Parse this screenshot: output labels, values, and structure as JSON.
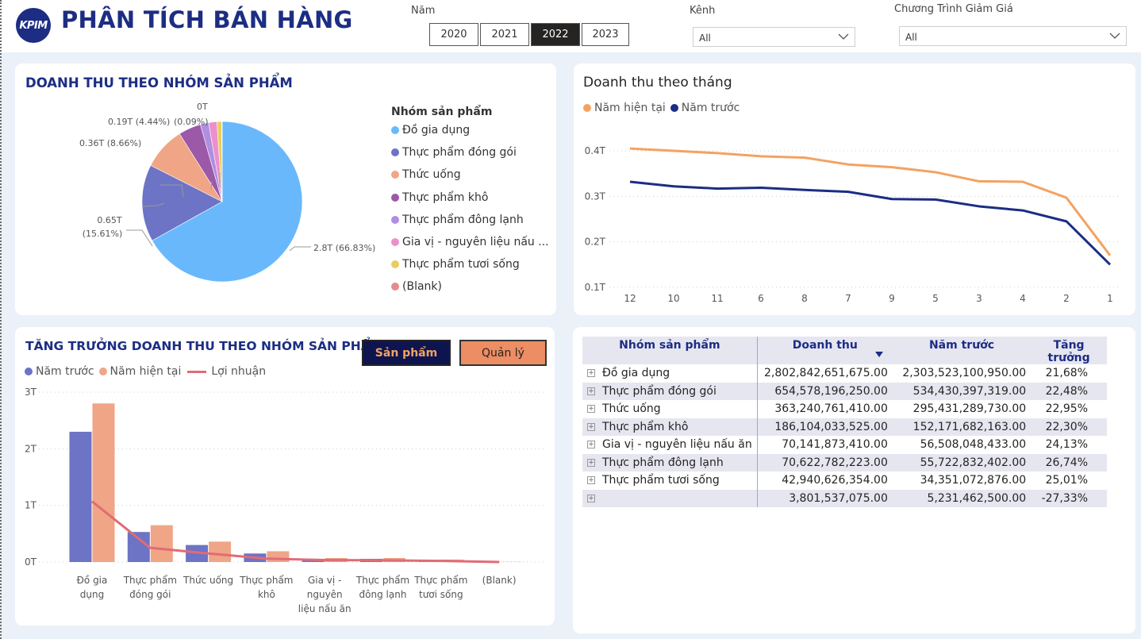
{
  "header": {
    "logo_text": "KPIM",
    "title": "PHÂN TÍCH BÁN HÀNG"
  },
  "filters": {
    "year_label": "Năm",
    "years": [
      "2020",
      "2021",
      "2022",
      "2023"
    ],
    "selected_year": "2022",
    "channel_label": "Kênh",
    "channel_value": "All",
    "discount_label": "Chương Trình Giảm Giá",
    "discount_value": "All"
  },
  "pie_card": {
    "title": "DOANH THU THEO NHÓM SẢN PHẨM",
    "legend_title": "Nhóm sản phẩm",
    "legend": [
      "Đồ gia dụng",
      "Thực phẩm đóng gói",
      "Thức uống",
      "Thực phẩm khô",
      "Thực phẩm đông lạnh",
      "Gia vị - nguyên liệu nấu ...",
      "Thực phẩm tươi sống",
      "(Blank)"
    ],
    "colors": [
      "#6ab8fc",
      "#6d73c5",
      "#f0a586",
      "#9b59a8",
      "#b08ee0",
      "#ee8fcd",
      "#e8cf5b",
      "#e58b8b"
    ],
    "labels": {
      "s0": "2.8T (66.83%)",
      "s1a": "0.65T",
      "s1b": "(15.61%)",
      "s2": "0.36T (8.66%)",
      "s3": "0.19T (4.44%)",
      "s4": "(0.09%)",
      "s5": "0T"
    }
  },
  "line_card": {
    "title": "Doanh thu theo tháng",
    "legend_current": "Năm hiện tại",
    "legend_previous": "Năm trước",
    "color_current": "#f4a261",
    "color_previous": "#1c2d83"
  },
  "bar_card": {
    "title": "TĂNG TRƯỞNG DOANH THU THEO NHÓM SẢN PHẨM",
    "btn_product": "Sản phẩm",
    "btn_manager": "Quản lý",
    "legend_prev": "Năm trước",
    "legend_curr": "Năm hiện tại",
    "legend_profit": "Lợi nhuận",
    "color_prev": "#6d73c5",
    "color_curr": "#f0a586",
    "color_profit": "#e06c75"
  },
  "table": {
    "headers": [
      "Nhóm sản phẩm",
      "Doanh thu",
      "Năm trước",
      "Tăng trưởng"
    ],
    "rows": [
      {
        "name": "Đồ gia dụng",
        "revenue": "2,802,842,651,675.00",
        "prev": "2,303,523,100,950.00",
        "growth": "21,68%"
      },
      {
        "name": "Thực phẩm đóng gói",
        "revenue": "654,578,196,250.00",
        "prev": "534,430,397,319.00",
        "growth": "22,48%"
      },
      {
        "name": "Thức uống",
        "revenue": "363,240,761,410.00",
        "prev": "295,431,289,730.00",
        "growth": "22,95%"
      },
      {
        "name": "Thực phẩm khô",
        "revenue": "186,104,033,525.00",
        "prev": "152,171,682,163.00",
        "growth": "22,30%"
      },
      {
        "name": "Gia vị - nguyên liệu nấu ăn",
        "revenue": "70,141,873,410.00",
        "prev": "56,508,048,433.00",
        "growth": "24,13%"
      },
      {
        "name": "Thực phẩm đông lạnh",
        "revenue": "70,622,782,223.00",
        "prev": "55,722,832,402.00",
        "growth": "26,74%"
      },
      {
        "name": "Thực phẩm tươi sống",
        "revenue": "42,940,626,354.00",
        "prev": "34,351,072,876.00",
        "growth": "25,01%"
      },
      {
        "name": "",
        "revenue": "3,801,537,075.00",
        "prev": "5,231,462,500.00",
        "growth": "-27,33%"
      }
    ]
  },
  "chart_data": [
    {
      "type": "pie",
      "title": "DOANH THU THEO NHÓM SẢN PHẨM",
      "categories": [
        "Đồ gia dụng",
        "Thực phẩm đóng gói",
        "Thức uống",
        "Thực phẩm khô",
        "Thực phẩm đông lạnh",
        "Gia vị - nguyên liệu nấu ăn",
        "Thực phẩm tươi sống",
        "(Blank)"
      ],
      "values": [
        2.8,
        0.65,
        0.36,
        0.19,
        0.07,
        0.07,
        0.04,
        0.0038
      ],
      "percents": [
        66.83,
        15.61,
        8.66,
        4.44,
        1.68,
        1.67,
        1.02,
        0.09
      ],
      "legend_position": "right"
    },
    {
      "type": "line",
      "title": "Doanh thu theo tháng",
      "x": [
        "12",
        "10",
        "11",
        "6",
        "8",
        "7",
        "9",
        "5",
        "3",
        "4",
        "2",
        "1"
      ],
      "series": [
        {
          "name": "Năm hiện tại",
          "values": [
            0.405,
            0.4,
            0.395,
            0.388,
            0.385,
            0.37,
            0.364,
            0.353,
            0.333,
            0.332,
            0.297,
            0.17
          ]
        },
        {
          "name": "Năm trước",
          "values": [
            0.332,
            0.322,
            0.317,
            0.319,
            0.314,
            0.31,
            0.294,
            0.293,
            0.278,
            0.269,
            0.245,
            0.15
          ]
        }
      ],
      "yticks": [
        "0.1T",
        "0.2T",
        "0.3T",
        "0.4T"
      ],
      "ylim": [
        0.1,
        0.4
      ],
      "grid": true,
      "legend_position": "top-left"
    },
    {
      "type": "bar",
      "title": "TĂNG TRƯỞNG DOANH THU THEO NHÓM SẢN PHẨM",
      "categories": [
        [
          "Đồ gia",
          "dụng"
        ],
        [
          "Thực phẩm",
          "đóng gói"
        ],
        [
          "Thức uống"
        ],
        [
          "Thực phẩm",
          "khô"
        ],
        [
          "Gia vị -",
          "nguyên",
          "liệu nấu ăn"
        ],
        [
          "Thực phẩm",
          "đông lạnh"
        ],
        [
          "Thực phẩm",
          "tươi sống"
        ],
        [
          "(Blank)"
        ]
      ],
      "series": [
        {
          "name": "Năm trước",
          "values": [
            2.3,
            0.53,
            0.3,
            0.15,
            0.056,
            0.056,
            0.034,
            0.005
          ]
        },
        {
          "name": "Năm hiện tại",
          "values": [
            2.8,
            0.65,
            0.36,
            0.19,
            0.07,
            0.07,
            0.043,
            0.004
          ]
        },
        {
          "name": "Lợi nhuận",
          "type": "line",
          "values": [
            1.07,
            0.25,
            0.15,
            0.06,
            0.035,
            0.03,
            0.02,
            0.0
          ]
        }
      ],
      "yticks": [
        "0T",
        "1T",
        "2T",
        "3T"
      ],
      "ylim": [
        0,
        3
      ],
      "grid": true,
      "legend_position": "top-left"
    }
  ]
}
